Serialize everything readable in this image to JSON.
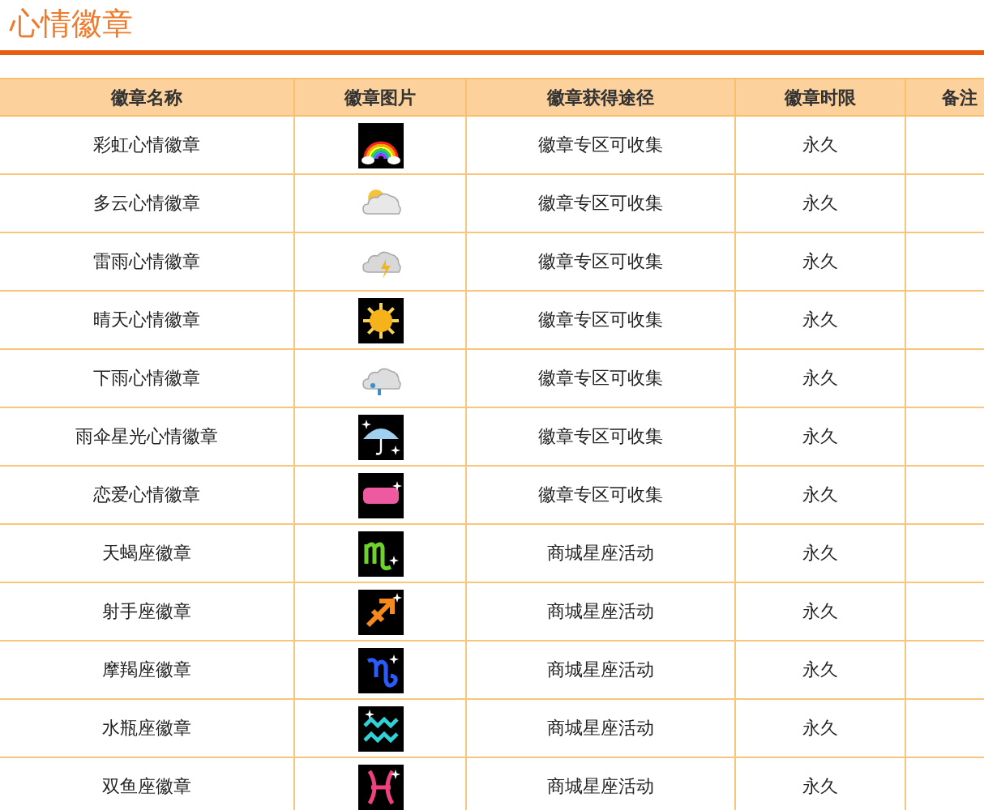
{
  "title": "心情徽章",
  "table": {
    "columns": [
      "徽章名称",
      "徽章图片",
      "徽章获得途径",
      "徽章时限",
      "备注"
    ],
    "rows": [
      {
        "name": "彩虹心情徽章",
        "badge": {
          "kind": "rainbow"
        },
        "source": "徽章专区可收集",
        "duration": "永久"
      },
      {
        "name": "多云心情徽章",
        "badge": {
          "kind": "cloudy"
        },
        "source": "徽章专区可收集",
        "duration": "永久"
      },
      {
        "name": "雷雨心情徽章",
        "badge": {
          "kind": "thunder"
        },
        "source": "徽章专区可收集",
        "duration": "永久"
      },
      {
        "name": "晴天心情徽章",
        "badge": {
          "kind": "sunny"
        },
        "source": "徽章专区可收集",
        "duration": "永久"
      },
      {
        "name": "下雨心情徽章",
        "badge": {
          "kind": "rain"
        },
        "source": "徽章专区可收集",
        "duration": "永久"
      },
      {
        "name": "雨伞星光心情徽章",
        "badge": {
          "kind": "umbrella"
        },
        "source": "徽章专区可收集",
        "duration": "永久"
      },
      {
        "name": "恋爱心情徽章",
        "badge": {
          "kind": "love"
        },
        "source": "徽章专区可收集",
        "duration": "永久"
      },
      {
        "name": "天蝎座徽章",
        "badge": {
          "kind": "scorpio"
        },
        "source": "商城星座活动",
        "duration": "永久"
      },
      {
        "name": "射手座徽章",
        "badge": {
          "kind": "sagittarius"
        },
        "source": "商城星座活动",
        "duration": "永久"
      },
      {
        "name": "摩羯座徽章",
        "badge": {
          "kind": "capricorn"
        },
        "source": "商城星座活动",
        "duration": "永久"
      },
      {
        "name": "水瓶座徽章",
        "badge": {
          "kind": "aquarius"
        },
        "source": "商城星座活动",
        "duration": "永久"
      },
      {
        "name": "双鱼座徽章",
        "badge": {
          "kind": "pisces"
        },
        "source": "商城星座活动",
        "duration": "永久"
      }
    ]
  }
}
